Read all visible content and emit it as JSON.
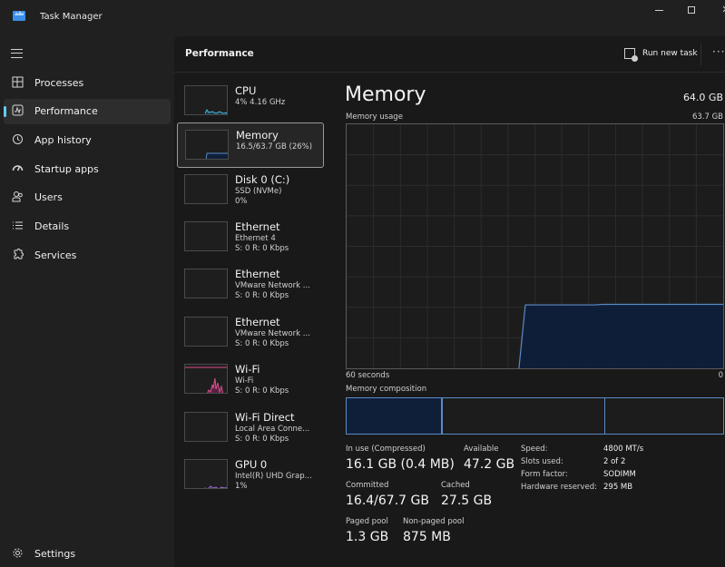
{
  "window": {
    "title": "Task Manager",
    "controls": {
      "minimize": "minimize",
      "maximize": "maximize",
      "close": "✕"
    }
  },
  "sidebar": {
    "menu_icon": "hamburger-icon",
    "items": [
      {
        "label": "Processes",
        "icon": "processes-icon",
        "active": false
      },
      {
        "label": "Performance",
        "icon": "performance-icon",
        "active": true
      },
      {
        "label": "App history",
        "icon": "history-icon",
        "active": false
      },
      {
        "label": "Startup apps",
        "icon": "speedometer-icon",
        "active": false
      },
      {
        "label": "Users",
        "icon": "users-icon",
        "active": false
      },
      {
        "label": "Details",
        "icon": "list-icon",
        "active": false
      },
      {
        "label": "Services",
        "icon": "puzzle-icon",
        "active": false
      }
    ],
    "settings_label": "Settings"
  },
  "header": {
    "title": "Performance",
    "run_new_task": "Run new task",
    "more": "···"
  },
  "resources": [
    {
      "name": "CPU",
      "sub": "4%  4.16 GHz",
      "sub2": "",
      "color": "#4db3d6",
      "selected": false
    },
    {
      "name": "Memory",
      "sub": "16.5/63.7 GB (26%)",
      "sub2": "",
      "color": "#5a8ac4",
      "selected": true
    },
    {
      "name": "Disk 0 (C:)",
      "sub": "SSD (NVMe)",
      "sub2": "0%",
      "color": "#6aa84f",
      "selected": false
    },
    {
      "name": "Ethernet",
      "sub": "Ethernet 4",
      "sub2": "S: 0 R: 0 Kbps",
      "color": "#c27ba0",
      "selected": false
    },
    {
      "name": "Ethernet",
      "sub": "VMware Network ...",
      "sub2": "S: 0 R: 0 Kbps",
      "color": "#c27ba0",
      "selected": false
    },
    {
      "name": "Ethernet",
      "sub": "VMware Network ...",
      "sub2": "S: 0 R: 0 Kbps",
      "color": "#c27ba0",
      "selected": false
    },
    {
      "name": "Wi-Fi",
      "sub": "Wi-Fi",
      "sub2": "S: 0 R: 0 Kbps",
      "color": "#d94f8a",
      "selected": false
    },
    {
      "name": "Wi-Fi Direct",
      "sub": "Local Area Conne...",
      "sub2": "S: 0 R: 0 Kbps",
      "color": "#c27ba0",
      "selected": false
    },
    {
      "name": "GPU 0",
      "sub": "Intel(R) UHD Grap...",
      "sub2": "1%",
      "color": "#9c6ad6",
      "selected": false
    }
  ],
  "detail": {
    "title": "Memory",
    "total": "64.0 GB",
    "usage_label": "Memory usage",
    "usage_max": "63.7 GB",
    "axis_left": "60 seconds",
    "axis_right": "0",
    "composition_label": "Memory composition",
    "chart": {
      "max_gb": 63.7,
      "window_seconds": 60,
      "usage_fraction_series": [
        0,
        0,
        0,
        0,
        0,
        0,
        0,
        0,
        0,
        0,
        0,
        0,
        0,
        0,
        0,
        0,
        0,
        0,
        0,
        0,
        0,
        0,
        0,
        0,
        0,
        0,
        0,
        0,
        0.26,
        0.26,
        0.26,
        0.26,
        0.26,
        0.26,
        0.26,
        0.26,
        0.26,
        0.26,
        0.26,
        0.26,
        0.262,
        0.262,
        0.262,
        0.262,
        0.262,
        0.262,
        0.262,
        0.262,
        0.262,
        0.262,
        0.262,
        0.262,
        0.262,
        0.262,
        0.262,
        0.262,
        0.262,
        0.262,
        0.262,
        0.262
      ],
      "line_color": "#5a8ac4",
      "fill_color": "#0f1f3a"
    },
    "composition": {
      "in_use_fraction": 0.253,
      "modified_fraction": 0.003,
      "standby_fraction": 0.43,
      "free_fraction": 0.314
    },
    "stats": [
      {
        "label": "In use (Compressed)",
        "value": "16.1 GB (0.4 MB)"
      },
      {
        "label": "Available",
        "value": "47.2 GB"
      },
      {
        "label": "Committed",
        "value": "16.4/67.7 GB"
      },
      {
        "label": "Cached",
        "value": "27.5 GB"
      },
      {
        "label": "Paged pool",
        "value": "1.3 GB"
      },
      {
        "label": "Non-paged pool",
        "value": "875 MB"
      }
    ],
    "specs": [
      {
        "label": "Speed:",
        "value": "4800 MT/s"
      },
      {
        "label": "Slots used:",
        "value": "2 of 2"
      },
      {
        "label": "Form factor:",
        "value": "SODIMM"
      },
      {
        "label": "Hardware reserved:",
        "value": "295 MB"
      }
    ]
  }
}
